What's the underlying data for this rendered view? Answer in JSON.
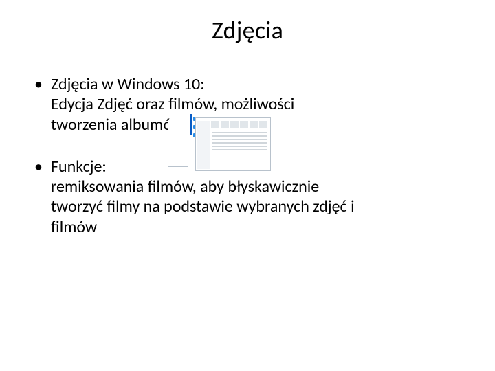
{
  "title": "Zdjęcia",
  "bullets": [
    {
      "head": "Zdjęcia w Windows 10:",
      "line1": "Edycja Zdjęć oraz filmów, możliwości",
      "line2": "tworzenia albumów"
    },
    {
      "head": "Funkcje:",
      "line1": " remiksowania filmów, aby błyskawicznie",
      "line2": "tworzyć filmy na podstawie wybranych zdjęć i",
      "line3": "filmów"
    }
  ],
  "image_alt": "Windows 10 desktop with file explorer window"
}
